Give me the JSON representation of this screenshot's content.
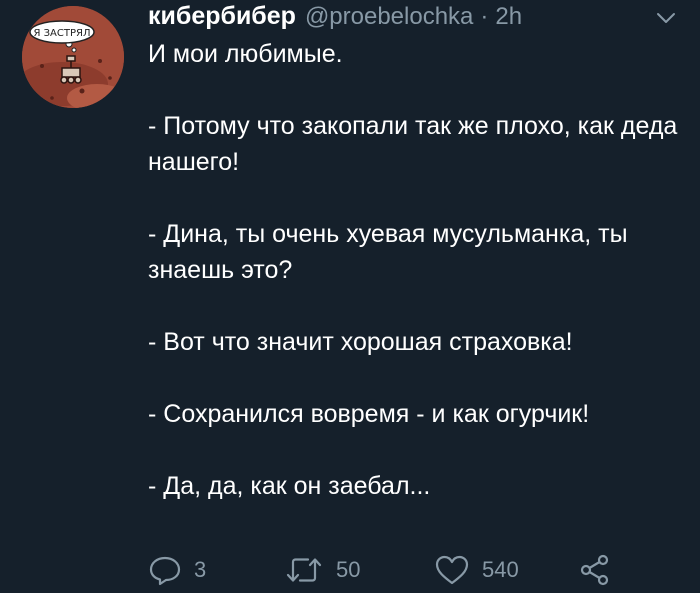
{
  "tweet": {
    "author": {
      "display_name": "кибербибер",
      "handle": "@proebelochka",
      "avatar_badge_text": "Я ЗАСТРЯЛ"
    },
    "separator": "·",
    "time": "2h",
    "paragraphs": [
      "И мои любимые.",
      "- Потому что закопали так же плохо, как деда нашего!",
      "- Дина, ты очень хуевая мусульманка, ты знаешь это?",
      "- Вот что значит хорошая страховка!",
      "- Сохранился вовремя - и как огурчик!",
      "- Да, да, как он заебал..."
    ],
    "actions": {
      "reply": {
        "icon": "reply-icon",
        "count": "3"
      },
      "retweet": {
        "icon": "retweet-icon",
        "count": "50"
      },
      "like": {
        "icon": "heart-icon",
        "count": "540"
      },
      "share": {
        "icon": "share-icon"
      }
    },
    "more_icon": "chevron-down-icon"
  },
  "colors": {
    "background": "#15202b",
    "text_primary": "#ffffff",
    "text_secondary": "#8899a6"
  }
}
